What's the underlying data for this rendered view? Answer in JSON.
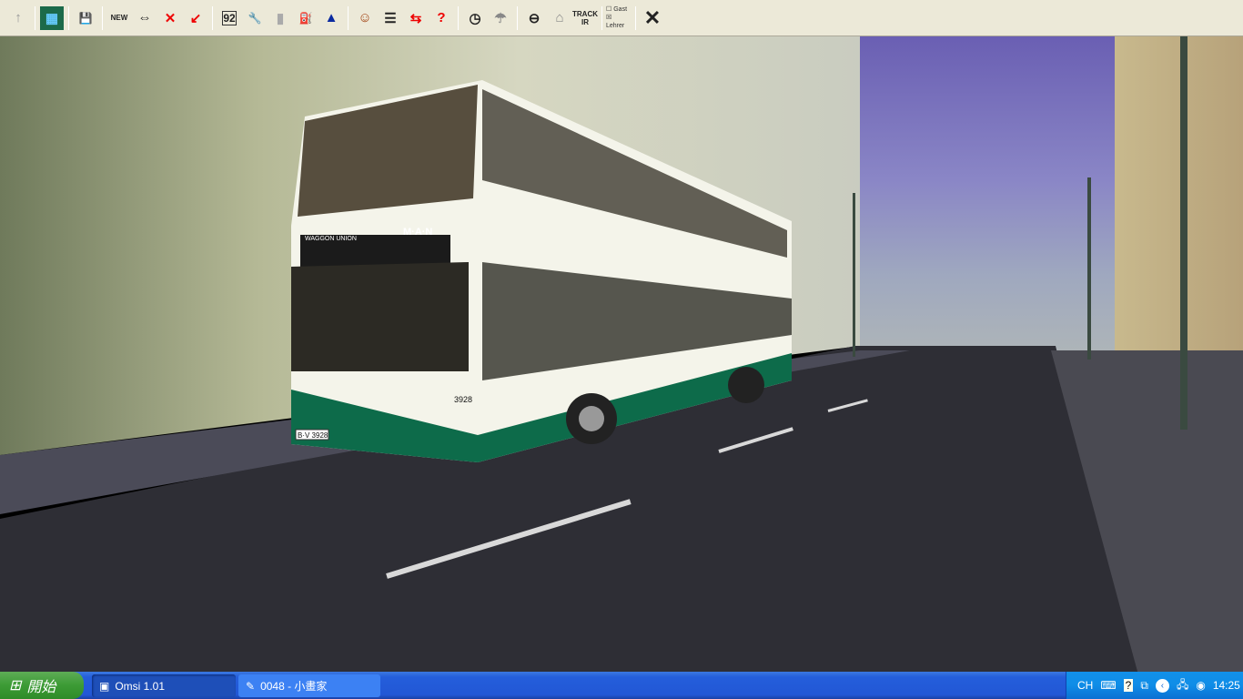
{
  "toolbar": {
    "items": [
      {
        "name": "up-arrow",
        "glyph": "↑"
      },
      {
        "name": "map",
        "glyph": "▦"
      },
      {
        "name": "save",
        "glyph": "💾"
      },
      {
        "name": "new-bus",
        "glyph": "NEW"
      },
      {
        "name": "switch-bus",
        "glyph": "⇔"
      },
      {
        "name": "delete-bus",
        "glyph": "✕"
      },
      {
        "name": "pointer",
        "glyph": "↙"
      },
      {
        "name": "route-92",
        "glyph": "92"
      },
      {
        "name": "repair",
        "glyph": "🔧"
      },
      {
        "name": "ticket",
        "glyph": "▮"
      },
      {
        "name": "fuel",
        "glyph": "⛽"
      },
      {
        "name": "bell",
        "glyph": "▲"
      },
      {
        "name": "driver",
        "glyph": "☺"
      },
      {
        "name": "timetable",
        "glyph": "☰"
      },
      {
        "name": "pc-driver",
        "glyph": "⇆"
      },
      {
        "name": "help",
        "glyph": "?"
      },
      {
        "name": "clock",
        "glyph": "◷"
      },
      {
        "name": "weather",
        "glyph": "☂"
      },
      {
        "name": "steering-wheel",
        "glyph": "⊖"
      },
      {
        "name": "mouse",
        "glyph": "⌂"
      },
      {
        "name": "trackir",
        "glyph": "TRACK IR"
      }
    ],
    "checkboxes": [
      {
        "label": "Gast",
        "checked": false
      },
      {
        "label": "Lehrer",
        "checked": true
      }
    ],
    "close_glyph": "✕"
  },
  "bus": {
    "manufacturer": "M·A·N",
    "body": "WAGGON UNION",
    "fleet_number": "3928",
    "plate": "B·V 3928"
  },
  "taskbar": {
    "start_label": "開始",
    "tasks": [
      {
        "label": "Omsi 1.01",
        "active": true
      },
      {
        "label": "0048 - 小畫家",
        "active": false
      }
    ],
    "tray": {
      "language": "CH",
      "time": "14:25"
    }
  }
}
